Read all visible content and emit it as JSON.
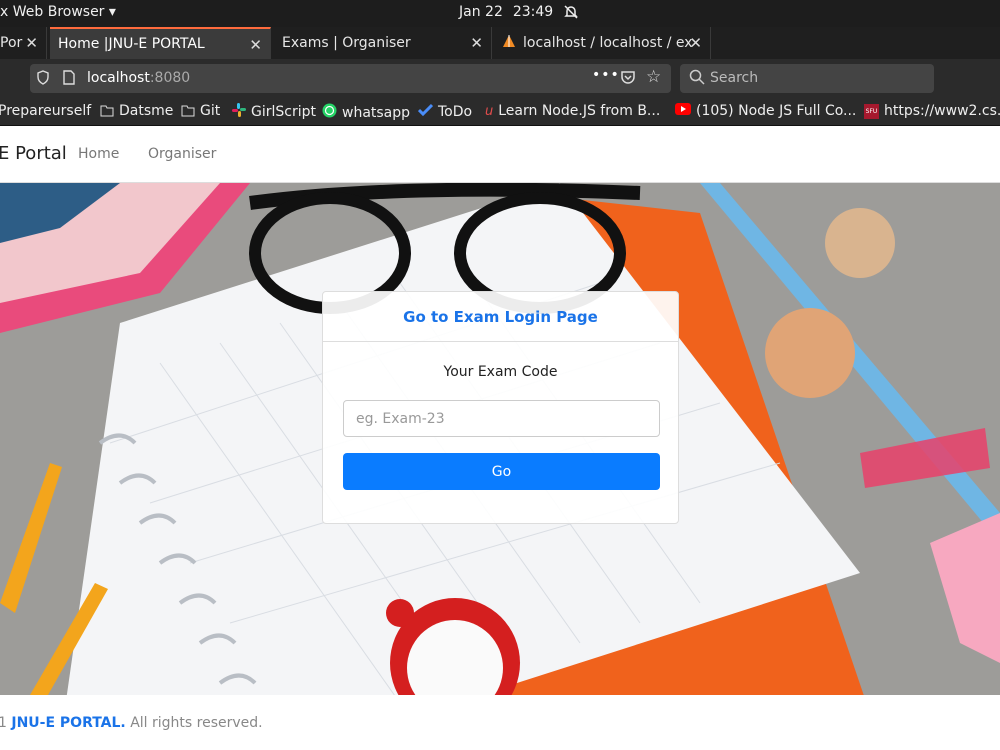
{
  "system": {
    "app_menu": "x Web Browser ▾",
    "date": "Jan 22",
    "time": "23:49"
  },
  "browser": {
    "tabs": [
      {
        "label": "Por"
      },
      {
        "label": "Home |JNU-E PORTAL"
      },
      {
        "label": "Exams | Organiser"
      },
      {
        "label": "localhost / localhost / ex"
      }
    ],
    "url_host": "localhost",
    "url_port": ":8080",
    "search_placeholder": "Search",
    "bookmarks": [
      {
        "label": "Prepareurself"
      },
      {
        "label": "Datsme"
      },
      {
        "label": "Git"
      },
      {
        "label": "GirlScript"
      },
      {
        "label": "whatsapp"
      },
      {
        "label": "ToDo"
      },
      {
        "label": "Learn Node.JS from B..."
      },
      {
        "label": "(105) Node JS Full Co..."
      },
      {
        "label": "https://www2.cs.s"
      }
    ]
  },
  "site": {
    "brand": "E Portal",
    "nav": [
      {
        "label": "Home"
      },
      {
        "label": "Organiser"
      }
    ],
    "card": {
      "title": "Go to Exam Login Page",
      "label": "Your Exam Code",
      "placeholder": "eg. Exam-23",
      "button": "Go"
    },
    "footer": {
      "prefix": "1 ",
      "brand": "JNU-E PORTAL.",
      "text": " All rights reserved."
    }
  },
  "colors": {
    "accent": "#0a7cff",
    "link": "#1a73e8",
    "tab_highlight": "#ff6b3d"
  }
}
